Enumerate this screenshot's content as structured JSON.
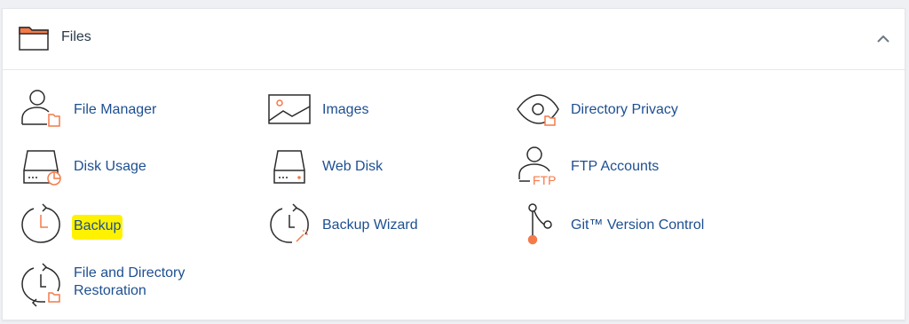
{
  "section": {
    "title": "Files",
    "collapse_icon": "chevron-up-icon",
    "header_icon": "folder-icon"
  },
  "colors": {
    "link": "#1d4f91",
    "icon_stroke": "#2b2b2b",
    "accent": "#f47a4a",
    "highlight": "#fff200"
  },
  "tools": {
    "file_manager": {
      "label": "File Manager",
      "icon": "file-manager-icon"
    },
    "images": {
      "label": "Images",
      "icon": "images-icon"
    },
    "directory_privacy": {
      "label": "Directory Privacy",
      "icon": "directory-privacy-icon"
    },
    "disk_usage": {
      "label": "Disk Usage",
      "icon": "disk-usage-icon"
    },
    "web_disk": {
      "label": "Web Disk",
      "icon": "web-disk-icon"
    },
    "ftp_accounts": {
      "label": "FTP Accounts",
      "icon": "ftp-accounts-icon",
      "icon_text": "FTP"
    },
    "backup": {
      "label": "Backup",
      "icon": "backup-icon",
      "highlighted": true
    },
    "backup_wizard": {
      "label": "Backup Wizard",
      "icon": "backup-wizard-icon"
    },
    "git_version_control": {
      "label": "Git™ Version Control",
      "icon": "git-icon"
    },
    "file_dir_restoration": {
      "label_line1": "File and Directory",
      "label_line2": "Restoration",
      "icon": "restoration-icon"
    }
  }
}
